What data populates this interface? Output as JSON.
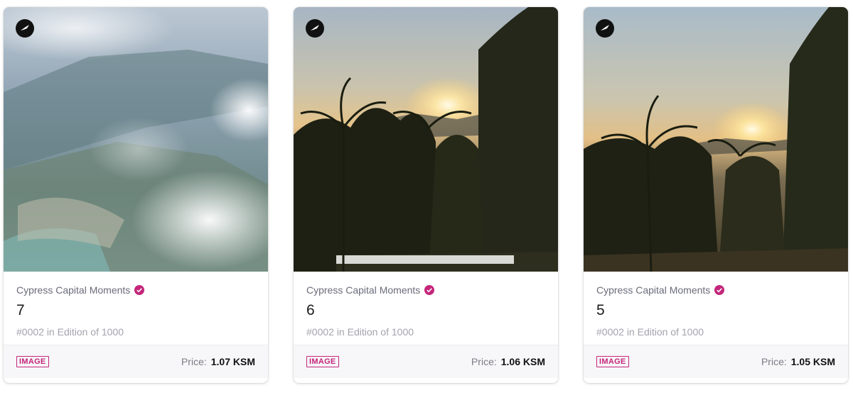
{
  "cards": [
    {
      "collection": "Cypress Capital Moments",
      "title": "7",
      "edition": "#0002 in Edition of 1000",
      "media_type": "IMAGE",
      "price_label": "Price:",
      "price_value": "1.07 KSM",
      "image_scene": "aerial-clouds-coastline"
    },
    {
      "collection": "Cypress Capital Moments",
      "title": "6",
      "edition": "#0002 in Edition of 1000",
      "media_type": "IMAGE",
      "price_label": "Price:",
      "price_value": "1.06 KSM",
      "image_scene": "sunset-palm-trees"
    },
    {
      "collection": "Cypress Capital Moments",
      "title": "5",
      "edition": "#0002 in Edition of 1000",
      "media_type": "IMAGE",
      "price_label": "Price:",
      "price_value": "1.05 KSM",
      "image_scene": "sunset-palm-trees"
    }
  ],
  "colors": {
    "accent": "#c4267a",
    "verified": "#c4267a",
    "footer_bg": "#f7f7f9"
  },
  "icons": {
    "badge": "bird-icon",
    "verified": "verified-check-icon"
  }
}
